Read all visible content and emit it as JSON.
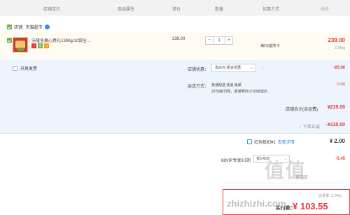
{
  "header": {
    "col_items": "店铺宝贝",
    "col_attrs": "商品属性",
    "col_price": "单价",
    "col_qty": "数量",
    "col_promo": "优惠方式",
    "col_subtotal": "小计"
  },
  "shop": {
    "prefix": "店铺:",
    "name": "天猫超市"
  },
  "item": {
    "title": "沃隆坚果心意礼1390g/10袋全...",
    "tags": [
      "7",
      "保",
      "G"
    ],
    "price": "239.00",
    "quantity": "1",
    "promo": "满2元超市卡",
    "subtotal": "239.00",
    "weight": "2.24kg"
  },
  "options": {
    "invoice_label": "开具发票",
    "shop_discount_label": "店铺优惠：",
    "shop_discount_select": "省20元:组合优惠",
    "shop_discount_amount": "-20.00",
    "shipping_label": "运送方式：",
    "shipping_line1": "普通配送 快递 免邮",
    "shipping_line2": "23:59前付款，承诺明日12:00前送达",
    "shipping_amount": "0.00",
    "shop_total_label": "店铺合计(含运费)",
    "shop_total_amount": "¥219.00"
  },
  "summary": {
    "instant_discount_label": "下单立减",
    "instant_discount_amount": "-¥110.00",
    "redpacket_label": "红包抵扣¥2",
    "redpacket_link": "查看详情",
    "redpacket_amount": "¥ 2.00",
    "vip_label": "88VIP专享9.5折",
    "vip_select": "省5.45元",
    "vip_amount": "-5.45",
    "pay_label": "实付款：",
    "pay_amount": "¥ 103.55",
    "total_weight": "总重量: 2.24kg",
    "address_hint": "寄送至"
  },
  "watermark": {
    "text": "值值",
    "url": "zhizhizhi.com"
  },
  "colors": {
    "accent_red": "#e4393c",
    "tmall_blue": "#3a8ee6",
    "options_bg": "#eef4fb",
    "item_bg": "#fffbf2"
  }
}
